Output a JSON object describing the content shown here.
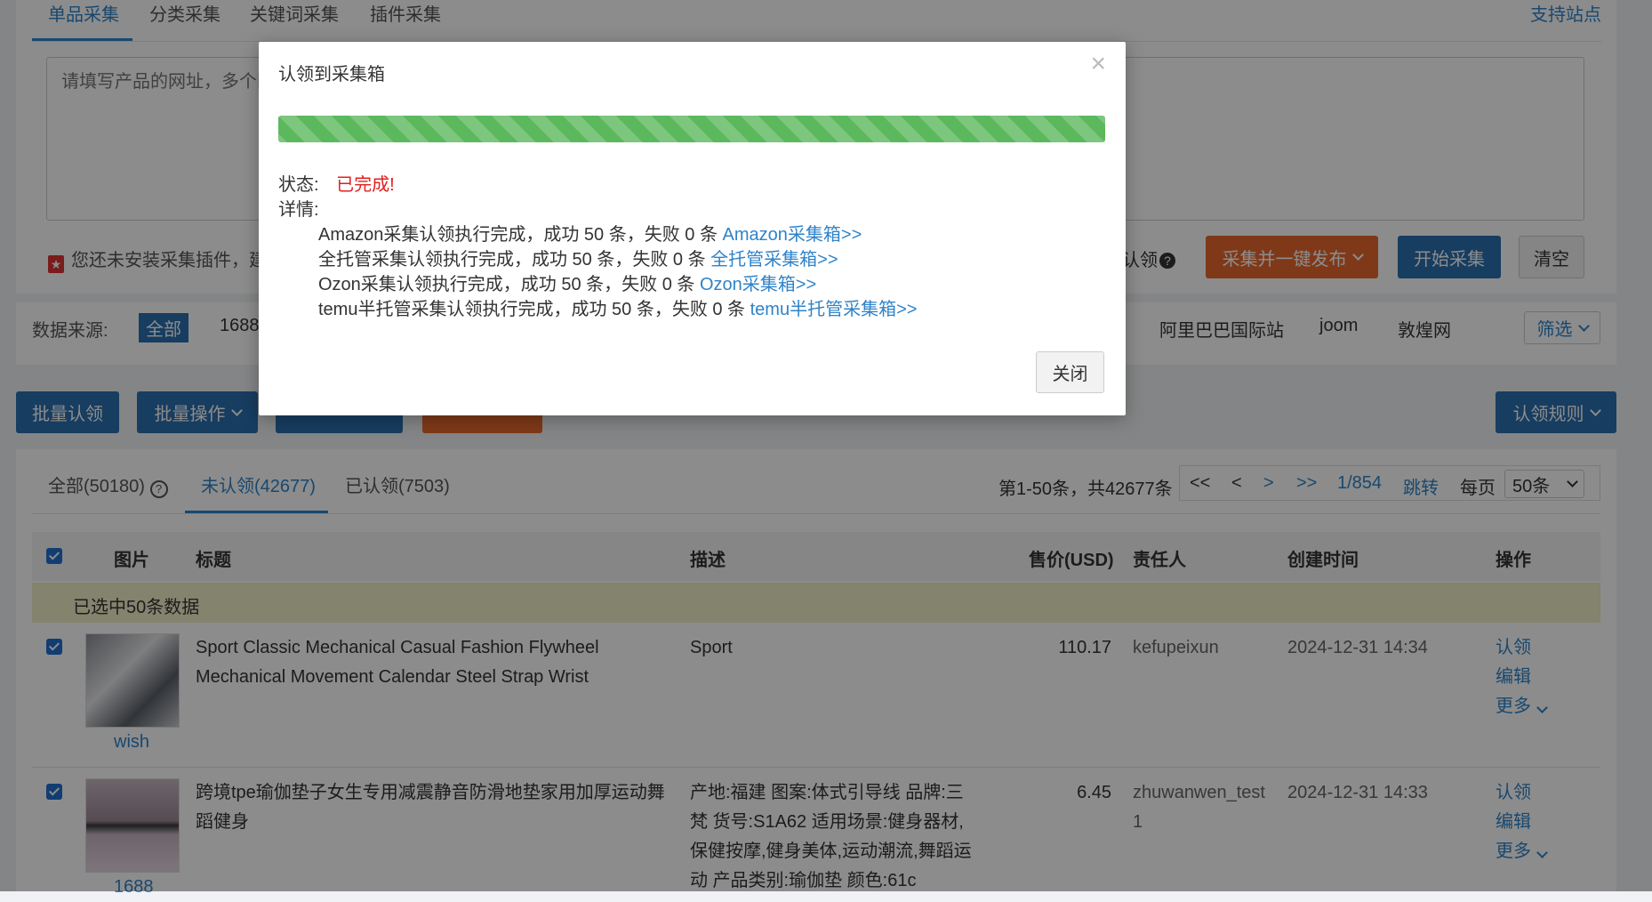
{
  "top_tabs": [
    "单品采集",
    "分类采集",
    "关键词采集",
    "插件采集"
  ],
  "support_link": "支持站点",
  "url_placeholder": "请填写产品的网址，多个网",
  "plugin_notice": "您还未安装采集插件，建",
  "toolbar": {
    "claim_label": "认领",
    "collect_publish": "采集并一键发布",
    "start_collect": "开始采集",
    "clear": "清空"
  },
  "source": {
    "label": "数据来源:",
    "all": "全部",
    "items": [
      "1688",
      "阿里巴巴国际站",
      "joom",
      "敦煌网"
    ],
    "filter": "筛选"
  },
  "actions": {
    "batch_claim": "批量认领",
    "batch_ops": "批量操作",
    "claim_rules": "认领规则"
  },
  "list_tabs": {
    "all": "全部(50180)",
    "unclaimed": "未认领(42677)",
    "claimed": "已认领(7503)"
  },
  "pagination": {
    "summary": "第1-50条，共42677条",
    "first": "<<",
    "prev": "<",
    "next": ">",
    "last": ">>",
    "page": "1/854",
    "jump": "跳转",
    "per_page_label": "每页",
    "per_page": "50条"
  },
  "table": {
    "headers": {
      "image": "图片",
      "title": "标题",
      "desc": "描述",
      "price": "售价(USD)",
      "owner": "责任人",
      "created": "创建时间",
      "ops": "操作"
    },
    "selected_text": "已选中50条数据",
    "rows": [
      {
        "source": "wish",
        "title": "Sport Classic Mechanical Casual Fashion Flywheel Mechanical Movement Calendar Steel Strap Wrist",
        "desc": "Sport",
        "price": "110.17",
        "owner": "kefupeixun",
        "created": "2024-12-31 14:34",
        "ops": [
          "认领",
          "编辑",
          "更多"
        ]
      },
      {
        "source": "1688",
        "title": "跨境tpe瑜伽垫子女生专用减震静音防滑地垫家用加厚运动舞蹈健身",
        "desc": "产地:福建 图案:体式引导线 品牌:三梵 货号:S1A62 适用场景:健身器材,保健按摩,健身美体,运动潮流,舞蹈运动 产品类别:瑜伽垫 颜色:61c",
        "price": "6.45",
        "owner": "zhuwanwen_test1",
        "created": "2024-12-31 14:33",
        "ops": [
          "认领",
          "编辑",
          "更多"
        ]
      }
    ]
  },
  "modal": {
    "title": "认领到采集箱",
    "close_x": "×",
    "progress": 1.0,
    "status_label": "状态:",
    "status_value": "已完成!",
    "detail_label": "详情:",
    "details": [
      {
        "text": "Amazon采集认领执行完成，成功 50 条，失败 0 条 ",
        "link": "Amazon采集箱>>"
      },
      {
        "text": "全托管采集认领执行完成，成功 50 条，失败 0 条 ",
        "link": "全托管采集箱>>"
      },
      {
        "text": "Ozon采集认领执行完成，成功 50 条，失败 0 条 ",
        "link": "Ozon采集箱>>"
      },
      {
        "text": "temu半托管采集认领执行完成，成功 50 条，失败 0 条 ",
        "link": "temu半托管采集箱>>"
      }
    ],
    "close_button": "关闭"
  },
  "colors": {
    "accent": "#2f83c9",
    "primary_button": "#2a6fb0",
    "orange_button": "#e8692c",
    "progress": "#5cb85c",
    "status_done": "#e02020"
  }
}
